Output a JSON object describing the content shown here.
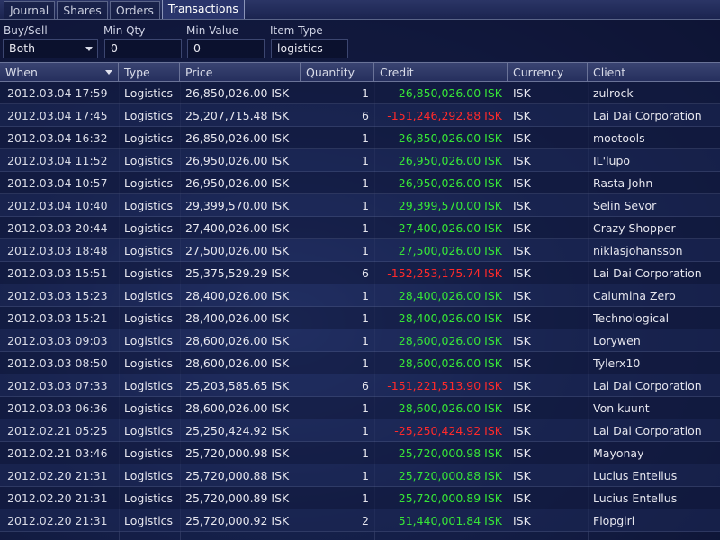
{
  "tabs": [
    {
      "label": "Journal",
      "active": false
    },
    {
      "label": "Shares",
      "active": false
    },
    {
      "label": "Orders",
      "active": false
    },
    {
      "label": "Transactions",
      "active": true
    }
  ],
  "filters": {
    "buy_sell": {
      "label": "Buy/Sell",
      "value": "Both"
    },
    "min_qty": {
      "label": "Min Qty",
      "value": "0"
    },
    "min_value": {
      "label": "Min Value",
      "value": "0"
    },
    "item_type": {
      "label": "Item Type",
      "value": "logistics"
    }
  },
  "columns": [
    "When",
    "Type",
    "Price",
    "Quantity",
    "Credit",
    "Currency",
    "Client"
  ],
  "colors": {
    "positive": "#37e637",
    "negative": "#ff2a2a"
  },
  "rows": [
    {
      "when": "2012.03.04  17:59",
      "type": "Logistics",
      "price": "26,850,026.00  ISK",
      "qty": "1",
      "credit": "26,850,026.00  ISK",
      "sign": "pos",
      "currency": "ISK",
      "client": "zulrock"
    },
    {
      "when": "2012.03.04  17:45",
      "type": "Logistics",
      "price": "25,207,715.48  ISK",
      "qty": "6",
      "credit": "-151,246,292.88  ISK",
      "sign": "neg",
      "currency": "ISK",
      "client": "Lai Dai Corporation"
    },
    {
      "when": "2012.03.04  16:32",
      "type": "Logistics",
      "price": "26,850,026.00  ISK",
      "qty": "1",
      "credit": "26,850,026.00  ISK",
      "sign": "pos",
      "currency": "ISK",
      "client": "mootools"
    },
    {
      "when": "2012.03.04  11:52",
      "type": "Logistics",
      "price": "26,950,026.00  ISK",
      "qty": "1",
      "credit": "26,950,026.00  ISK",
      "sign": "pos",
      "currency": "ISK",
      "client": "IL'lupo"
    },
    {
      "when": "2012.03.04  10:57",
      "type": "Logistics",
      "price": "26,950,026.00  ISK",
      "qty": "1",
      "credit": "26,950,026.00  ISK",
      "sign": "pos",
      "currency": "ISK",
      "client": "Rasta John"
    },
    {
      "when": "2012.03.04  10:40",
      "type": "Logistics",
      "price": "29,399,570.00  ISK",
      "qty": "1",
      "credit": "29,399,570.00  ISK",
      "sign": "pos",
      "currency": "ISK",
      "client": "Selin Sevor"
    },
    {
      "when": "2012.03.03  20:44",
      "type": "Logistics",
      "price": "27,400,026.00  ISK",
      "qty": "1",
      "credit": "27,400,026.00  ISK",
      "sign": "pos",
      "currency": "ISK",
      "client": "Crazy Shopper"
    },
    {
      "when": "2012.03.03  18:48",
      "type": "Logistics",
      "price": "27,500,026.00  ISK",
      "qty": "1",
      "credit": "27,500,026.00  ISK",
      "sign": "pos",
      "currency": "ISK",
      "client": "niklasjohansson"
    },
    {
      "when": "2012.03.03  15:51",
      "type": "Logistics",
      "price": "25,375,529.29  ISK",
      "qty": "6",
      "credit": "-152,253,175.74  ISK",
      "sign": "neg",
      "currency": "ISK",
      "client": "Lai Dai Corporation"
    },
    {
      "when": "2012.03.03  15:23",
      "type": "Logistics",
      "price": "28,400,026.00  ISK",
      "qty": "1",
      "credit": "28,400,026.00  ISK",
      "sign": "pos",
      "currency": "ISK",
      "client": "Calumina Zero"
    },
    {
      "when": "2012.03.03  15:21",
      "type": "Logistics",
      "price": "28,400,026.00  ISK",
      "qty": "1",
      "credit": "28,400,026.00  ISK",
      "sign": "pos",
      "currency": "ISK",
      "client": "Technological"
    },
    {
      "when": "2012.03.03  09:03",
      "type": "Logistics",
      "price": "28,600,026.00  ISK",
      "qty": "1",
      "credit": "28,600,026.00  ISK",
      "sign": "pos",
      "currency": "ISK",
      "client": "Lorywen"
    },
    {
      "when": "2012.03.03  08:50",
      "type": "Logistics",
      "price": "28,600,026.00  ISK",
      "qty": "1",
      "credit": "28,600,026.00  ISK",
      "sign": "pos",
      "currency": "ISK",
      "client": "Tylerx10"
    },
    {
      "when": "2012.03.03  07:33",
      "type": "Logistics",
      "price": "25,203,585.65  ISK",
      "qty": "6",
      "credit": "-151,221,513.90  ISK",
      "sign": "neg",
      "currency": "ISK",
      "client": "Lai Dai Corporation"
    },
    {
      "when": "2012.03.03  06:36",
      "type": "Logistics",
      "price": "28,600,026.00  ISK",
      "qty": "1",
      "credit": "28,600,026.00  ISK",
      "sign": "pos",
      "currency": "ISK",
      "client": "Von kuunt"
    },
    {
      "when": "2012.02.21  05:25",
      "type": "Logistics",
      "price": "25,250,424.92  ISK",
      "qty": "1",
      "credit": "-25,250,424.92  ISK",
      "sign": "neg",
      "currency": "ISK",
      "client": "Lai Dai Corporation"
    },
    {
      "when": "2012.02.21  03:46",
      "type": "Logistics",
      "price": "25,720,000.98  ISK",
      "qty": "1",
      "credit": "25,720,000.98  ISK",
      "sign": "pos",
      "currency": "ISK",
      "client": "Mayonay"
    },
    {
      "when": "2012.02.20  21:31",
      "type": "Logistics",
      "price": "25,720,000.88  ISK",
      "qty": "1",
      "credit": "25,720,000.88  ISK",
      "sign": "pos",
      "currency": "ISK",
      "client": "Lucius Entellus"
    },
    {
      "when": "2012.02.20  21:31",
      "type": "Logistics",
      "price": "25,720,000.89  ISK",
      "qty": "1",
      "credit": "25,720,000.89  ISK",
      "sign": "pos",
      "currency": "ISK",
      "client": "Lucius Entellus"
    },
    {
      "when": "2012.02.20  21:31",
      "type": "Logistics",
      "price": "25,720,000.92  ISK",
      "qty": "2",
      "credit": "51,440,001.84  ISK",
      "sign": "pos",
      "currency": "ISK",
      "client": "Flopgirl"
    }
  ]
}
